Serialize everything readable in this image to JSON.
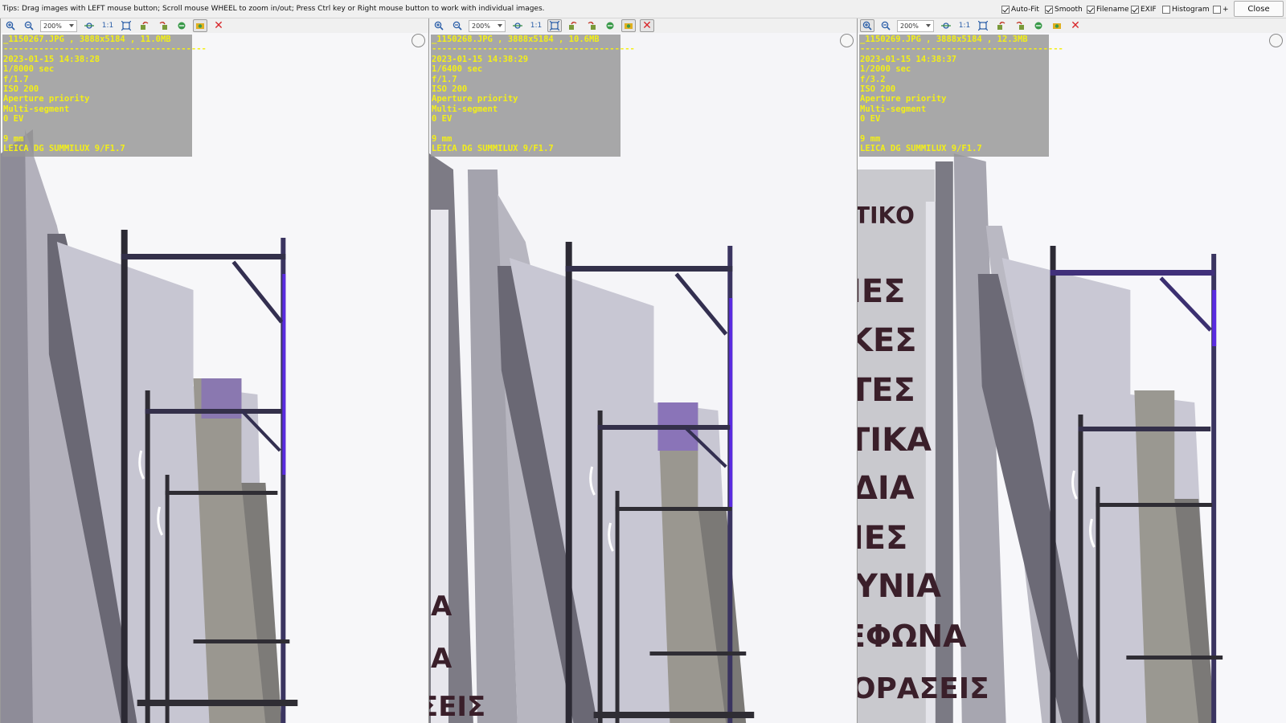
{
  "tips": "Tips: Drag images with LEFT mouse button; Scroll mouse WHEEL to zoom in/out; Press Ctrl key or Right mouse button to work with individual images.",
  "options": [
    {
      "label": "Auto-Fit",
      "checked": true
    },
    {
      "label": "Smooth",
      "checked": true
    },
    {
      "label": "Filename",
      "checked": true
    },
    {
      "label": "EXIF",
      "checked": true
    },
    {
      "label": "Histogram",
      "checked": false
    },
    {
      "label": "+",
      "checked": false
    }
  ],
  "close_label": "Close",
  "panes": [
    {
      "zoom": "200%",
      "one_to_one": "1:1",
      "filename_line": "_1150267.JPG , 3888x5184 , 11.0MB",
      "separator": "----------------------------------------",
      "datetime": "2023-01-15 14:38:28",
      "shutter": "1/8000 sec",
      "aperture": "f/1.7",
      "iso": "ISO 200",
      "mode": "Aperture priority",
      "metering": "Multi-segment",
      "ev": "0 EV",
      "focal": "9 mm",
      "lens": "LEICA DG SUMMILUX 9/F1.7"
    },
    {
      "zoom": "200%",
      "one_to_one": "1:1",
      "filename_line": "_1150268.JPG , 3888x5184 , 10.6MB",
      "separator": "----------------------------------------",
      "datetime": "2023-01-15 14:38:29",
      "shutter": "1/6400 sec",
      "aperture": "f/1.7",
      "iso": "ISO 200",
      "mode": "Aperture priority",
      "metering": "Multi-segment",
      "ev": "0 EV",
      "focal": "9 mm",
      "lens": "LEICA DG SUMMILUX 9/F1.7"
    },
    {
      "zoom": "200%",
      "one_to_one": "1:1",
      "filename_line": "_1150269.JPG , 3888x5184 , 12.3MB",
      "separator": "----------------------------------------",
      "datetime": "2023-01-15 14:38:37",
      "shutter": "1/2000 sec",
      "aperture": "f/3.2",
      "iso": "ISO 200",
      "mode": "Aperture priority",
      "metering": "Multi-segment",
      "ev": "0 EV",
      "focal": "9 mm",
      "lens": "LEICA DG SUMMILUX 9/F1.7"
    }
  ],
  "sign_text_pane2": [
    "Α",
    "Α",
    "ΣΕΙΣ"
  ],
  "sign_text_pane3": [
    "ΤΙΚΟ",
    "ΙΕΣ",
    "ΚΕΣ",
    "ΤΕΣ",
    "ΤΙΚΑ",
    "ΔΙΑ",
    "ΙΙΕΣ",
    "ΥΝΙΑ",
    "ΕΦΩΝΑ",
    "ΟΡΑΣΕΙΣ"
  ],
  "colors": {
    "exif_text": "#f3ef18",
    "fringe": "#5a2be0",
    "close_x": "#d8262a"
  }
}
